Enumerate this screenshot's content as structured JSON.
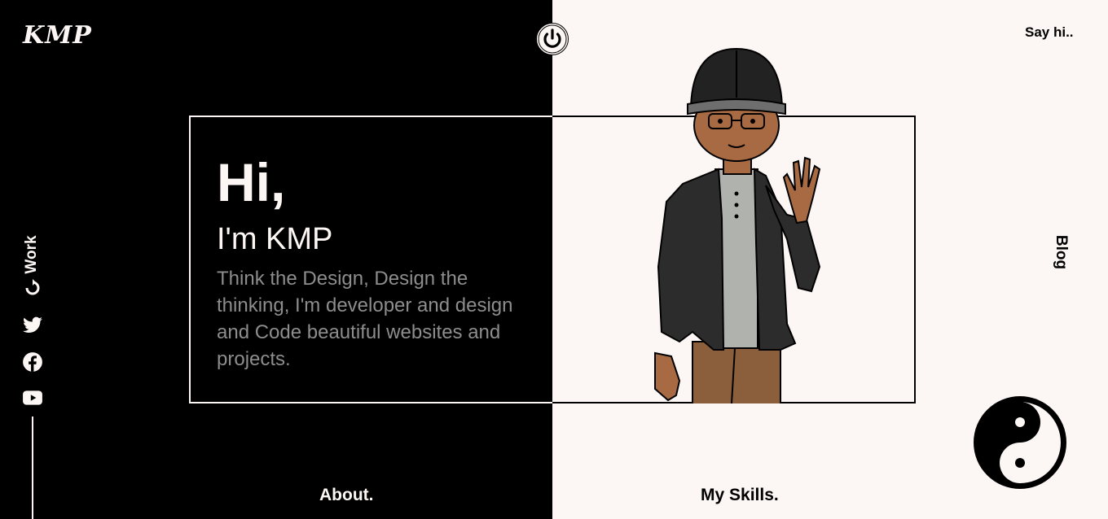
{
  "header": {
    "logo": "KMP",
    "say_hi": "Say hi.."
  },
  "nav": {
    "blog": "Blog",
    "work": "Work",
    "about": "About.",
    "skills": "My Skills."
  },
  "intro": {
    "greeting": "Hi,",
    "name": "I'm KMP",
    "description": "Think the Design, Design the thinking, I'm developer and design and Code beautiful websites and projects."
  },
  "social": [
    "twitter-icon",
    "facebook-icon",
    "youtube-icon"
  ],
  "colors": {
    "dark": "#000000",
    "light": "#fcf6f4",
    "muted": "#8d8d8d"
  }
}
